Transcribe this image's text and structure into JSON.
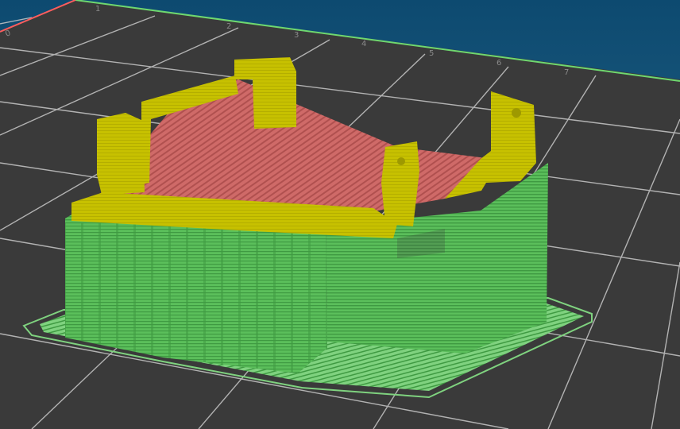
{
  "viewport": {
    "background_top": "#0d4a70",
    "background_bottom": "#2f6e90",
    "bed_color": "#3a3a3a",
    "grid_color": "#c8c8c8",
    "bed_edge_color": "#6fd86f",
    "bed_edge_left_color": "#ff5d5d"
  },
  "bed": {
    "tick_labels": [
      "0",
      "1",
      "2",
      "3",
      "4",
      "5",
      "6",
      "7"
    ]
  },
  "toolpath_colors": {
    "perimeter": "#5bbf5b",
    "perimeter_dark": "#3f9a42",
    "skirt": "#7fd27f",
    "support_material": "#c7c100",
    "support_material_dark": "#9e9900",
    "infill": "#cf6a68",
    "infill_dark": "#b0504f"
  }
}
